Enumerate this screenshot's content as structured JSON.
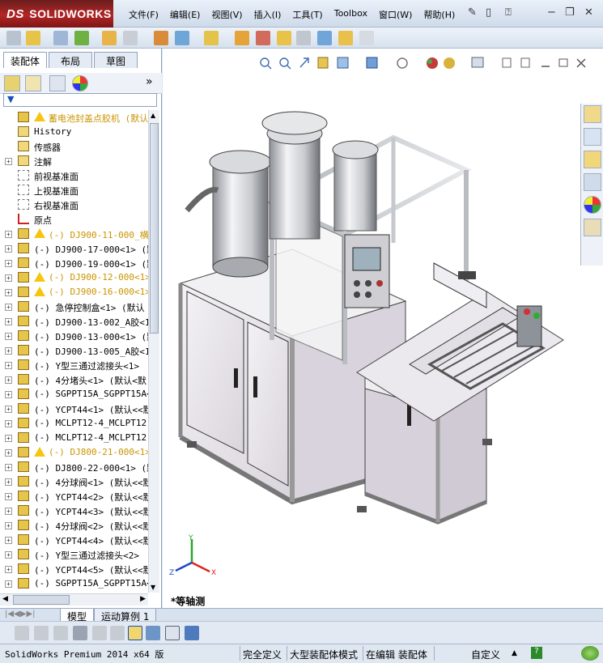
{
  "app": {
    "logo_text": "SOLIDWORKS",
    "logo_mark": "DS"
  },
  "menu": [
    "文件(F)",
    "编辑(E)",
    "视图(V)",
    "插入(I)",
    "工具(T)",
    "Toolbox",
    "窗口(W)",
    "帮助(H)"
  ],
  "panel": {
    "tabs": [
      "装配体",
      "布局",
      "草图"
    ],
    "filter_placeholder": ""
  },
  "tree": [
    {
      "label": "蓄电池封盖点胶机  (默认<",
      "icon": "assembly-icon",
      "warn": true,
      "yellow": true,
      "expander": "",
      "indent": 0
    },
    {
      "label": "History",
      "icon": "history-icon",
      "warn": false,
      "yellow": false,
      "expander": "",
      "indent": 1
    },
    {
      "label": "传感器",
      "icon": "sensor-icon",
      "warn": false,
      "yellow": false,
      "expander": "",
      "indent": 1
    },
    {
      "label": "注解",
      "icon": "annotation-icon",
      "warn": false,
      "yellow": false,
      "expander": "+",
      "indent": 1
    },
    {
      "label": "前视基准面",
      "icon": "plane-icon",
      "warn": false,
      "yellow": false,
      "expander": "",
      "indent": 1
    },
    {
      "label": "上视基准面",
      "icon": "plane-icon",
      "warn": false,
      "yellow": false,
      "expander": "",
      "indent": 1
    },
    {
      "label": "右视基准面",
      "icon": "plane-icon",
      "warn": false,
      "yellow": false,
      "expander": "",
      "indent": 1
    },
    {
      "label": "原点",
      "icon": "origin-icon",
      "warn": false,
      "yellow": false,
      "expander": "",
      "indent": 1
    },
    {
      "label": "(-) DJ900-11-000_横拉",
      "icon": "assembly-icon",
      "warn": true,
      "yellow": true,
      "expander": "+",
      "indent": 1
    },
    {
      "label": "(-) DJ900-17-000<1>  (默",
      "icon": "assembly-icon",
      "warn": false,
      "yellow": false,
      "expander": "+",
      "indent": 1
    },
    {
      "label": "(-) DJ900-19-000<1>  (默",
      "icon": "assembly-icon",
      "warn": false,
      "yellow": false,
      "expander": "+",
      "indent": 1
    },
    {
      "label": "(-) DJ900-12-000<1>",
      "icon": "assembly-icon",
      "warn": true,
      "yellow": true,
      "expander": "+",
      "indent": 1
    },
    {
      "label": "(-) DJ900-16-000<1>",
      "icon": "assembly-icon",
      "warn": true,
      "yellow": true,
      "expander": "+",
      "indent": 1
    },
    {
      "label": "(-) 急停控制盒<1>  (默认",
      "icon": "assembly-icon",
      "warn": false,
      "yellow": false,
      "expander": "+",
      "indent": 1
    },
    {
      "label": "(-) DJ900-13-002_A胶<1>",
      "icon": "assembly-icon",
      "warn": false,
      "yellow": false,
      "expander": "+",
      "indent": 1
    },
    {
      "label": "(-) DJ900-13-000<1>  (默",
      "icon": "assembly-icon",
      "warn": false,
      "yellow": false,
      "expander": "+",
      "indent": 1
    },
    {
      "label": "(-) DJ900-13-005_A胶<1>",
      "icon": "assembly-icon",
      "warn": false,
      "yellow": false,
      "expander": "+",
      "indent": 1
    },
    {
      "label": "(-) Y型三通过滤接头<1>",
      "icon": "assembly-icon",
      "warn": false,
      "yellow": false,
      "expander": "+",
      "indent": 1
    },
    {
      "label": "(-) 4分堵头<1>  (默认<默",
      "icon": "assembly-icon",
      "warn": false,
      "yellow": false,
      "expander": "+",
      "indent": 1
    },
    {
      "label": "(-) SGPPT15A_SGPPT15A<1",
      "icon": "assembly-icon",
      "warn": false,
      "yellow": false,
      "expander": "+",
      "indent": 1
    },
    {
      "label": "(-) YCPT44<1>  (默认<<默",
      "icon": "assembly-icon",
      "warn": false,
      "yellow": false,
      "expander": "+",
      "indent": 1
    },
    {
      "label": "(-) MCLPT12-4_MCLPT12-4",
      "icon": "assembly-icon",
      "warn": false,
      "yellow": false,
      "expander": "+",
      "indent": 1
    },
    {
      "label": "(-) MCLPT12-4_MCLPT12-4",
      "icon": "assembly-icon",
      "warn": false,
      "yellow": false,
      "expander": "+",
      "indent": 1
    },
    {
      "label": "(-) DJ800-21-000<1>",
      "icon": "assembly-icon",
      "warn": true,
      "yellow": true,
      "expander": "+",
      "indent": 1
    },
    {
      "label": "(-) DJ800-22-000<1>  (默",
      "icon": "assembly-icon",
      "warn": false,
      "yellow": false,
      "expander": "+",
      "indent": 1
    },
    {
      "label": "(-) 4分球阀<1>  (默认<<默",
      "icon": "assembly-icon",
      "warn": false,
      "yellow": false,
      "expander": "+",
      "indent": 1
    },
    {
      "label": "(-) YCPT44<2>  (默认<<默",
      "icon": "assembly-icon",
      "warn": false,
      "yellow": false,
      "expander": "+",
      "indent": 1
    },
    {
      "label": "(-) YCPT44<3>  (默认<<默",
      "icon": "assembly-icon",
      "warn": false,
      "yellow": false,
      "expander": "+",
      "indent": 1
    },
    {
      "label": "(-) 4分球阀<2>  (默认<<默",
      "icon": "assembly-icon",
      "warn": false,
      "yellow": false,
      "expander": "+",
      "indent": 1
    },
    {
      "label": "(-) YCPT44<4>  (默认<<默",
      "icon": "assembly-icon",
      "warn": false,
      "yellow": false,
      "expander": "+",
      "indent": 1
    },
    {
      "label": "(-) Y型三通过滤接头<2>",
      "icon": "assembly-icon",
      "warn": false,
      "yellow": false,
      "expander": "+",
      "indent": 1
    },
    {
      "label": "(-) YCPT44<5>  (默认<<默",
      "icon": "assembly-icon",
      "warn": false,
      "yellow": false,
      "expander": "+",
      "indent": 1
    },
    {
      "label": "(-) SGPPT15A_SGPPT15A<2",
      "icon": "assembly-icon",
      "warn": false,
      "yellow": false,
      "expander": "+",
      "indent": 1
    }
  ],
  "viewport": {
    "view_label": "*等轴测",
    "axis_labels": {
      "x": "X",
      "y": "Y",
      "z": "Z"
    }
  },
  "model_tabs": [
    "模型",
    "运动算例 1"
  ],
  "status": {
    "product": "SolidWorks Premium 2014 x64 版",
    "fully_defined": "完全定义",
    "large_assembly": "大型装配体模式",
    "editing": "在编辑 装配体",
    "units": "自定义",
    "units_arrow": "▲",
    "help": "?"
  },
  "colors": {
    "accent": "#1550b4",
    "warning": "#f6c511",
    "logo_red": "#b32626",
    "frame_gray": "#c5c8cc"
  }
}
